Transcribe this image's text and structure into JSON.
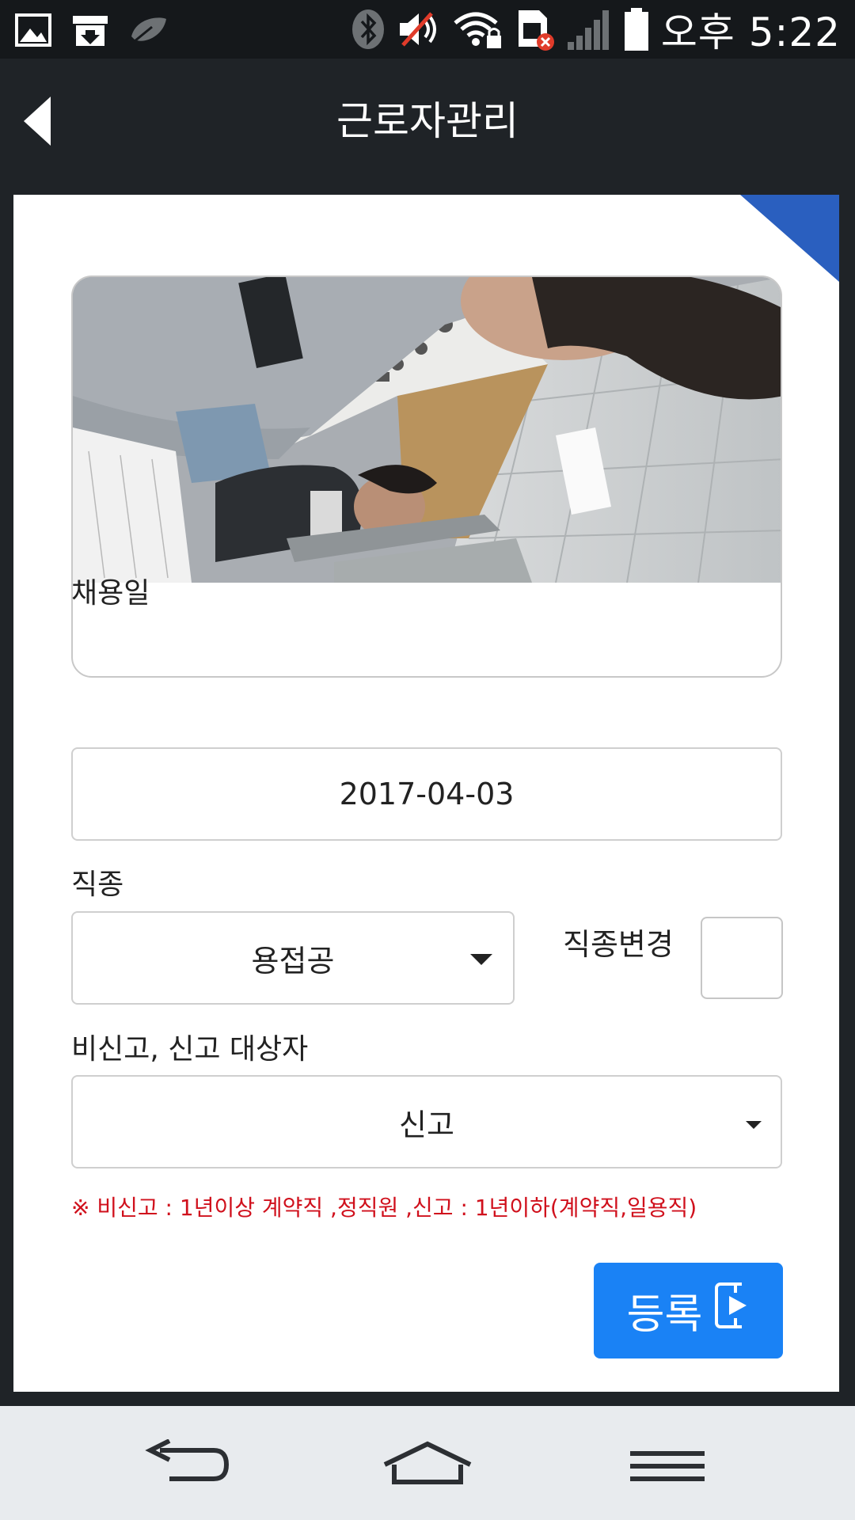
{
  "status_bar": {
    "left_icons": [
      "gallery-icon",
      "download-icon",
      "leaf-icon"
    ],
    "right_icons": [
      "bluetooth-icon",
      "mute-icon",
      "wifi-lock-icon",
      "sim-error-icon",
      "signal-icon",
      "battery-icon"
    ],
    "time": "오후 5:22"
  },
  "header": {
    "title": "근로자관리",
    "back_icon": "back-arrow-icon"
  },
  "form": {
    "hire_date": {
      "label": "채용일",
      "value": "2017-04-03"
    },
    "job_type": {
      "label": "직종",
      "value": "용접공",
      "change_label": "직종변경",
      "change_checked": false
    },
    "report": {
      "label": "비신고, 신고 대상자",
      "value": "신고"
    },
    "notice": "※ 비신고 : 1년이상 계약직 ,정직원  ,신고 : 1년이하(계약직,일용직)",
    "register_label": "등록",
    "register_icon": "door-enter-icon"
  },
  "nav": {
    "icons": [
      "back-nav-icon",
      "home-icon",
      "menu-icon"
    ]
  },
  "colors": {
    "accent": "#1a82f5",
    "corner": "#2a5fbf",
    "notice": "#d0101c",
    "header_bg": "#1f2327"
  }
}
